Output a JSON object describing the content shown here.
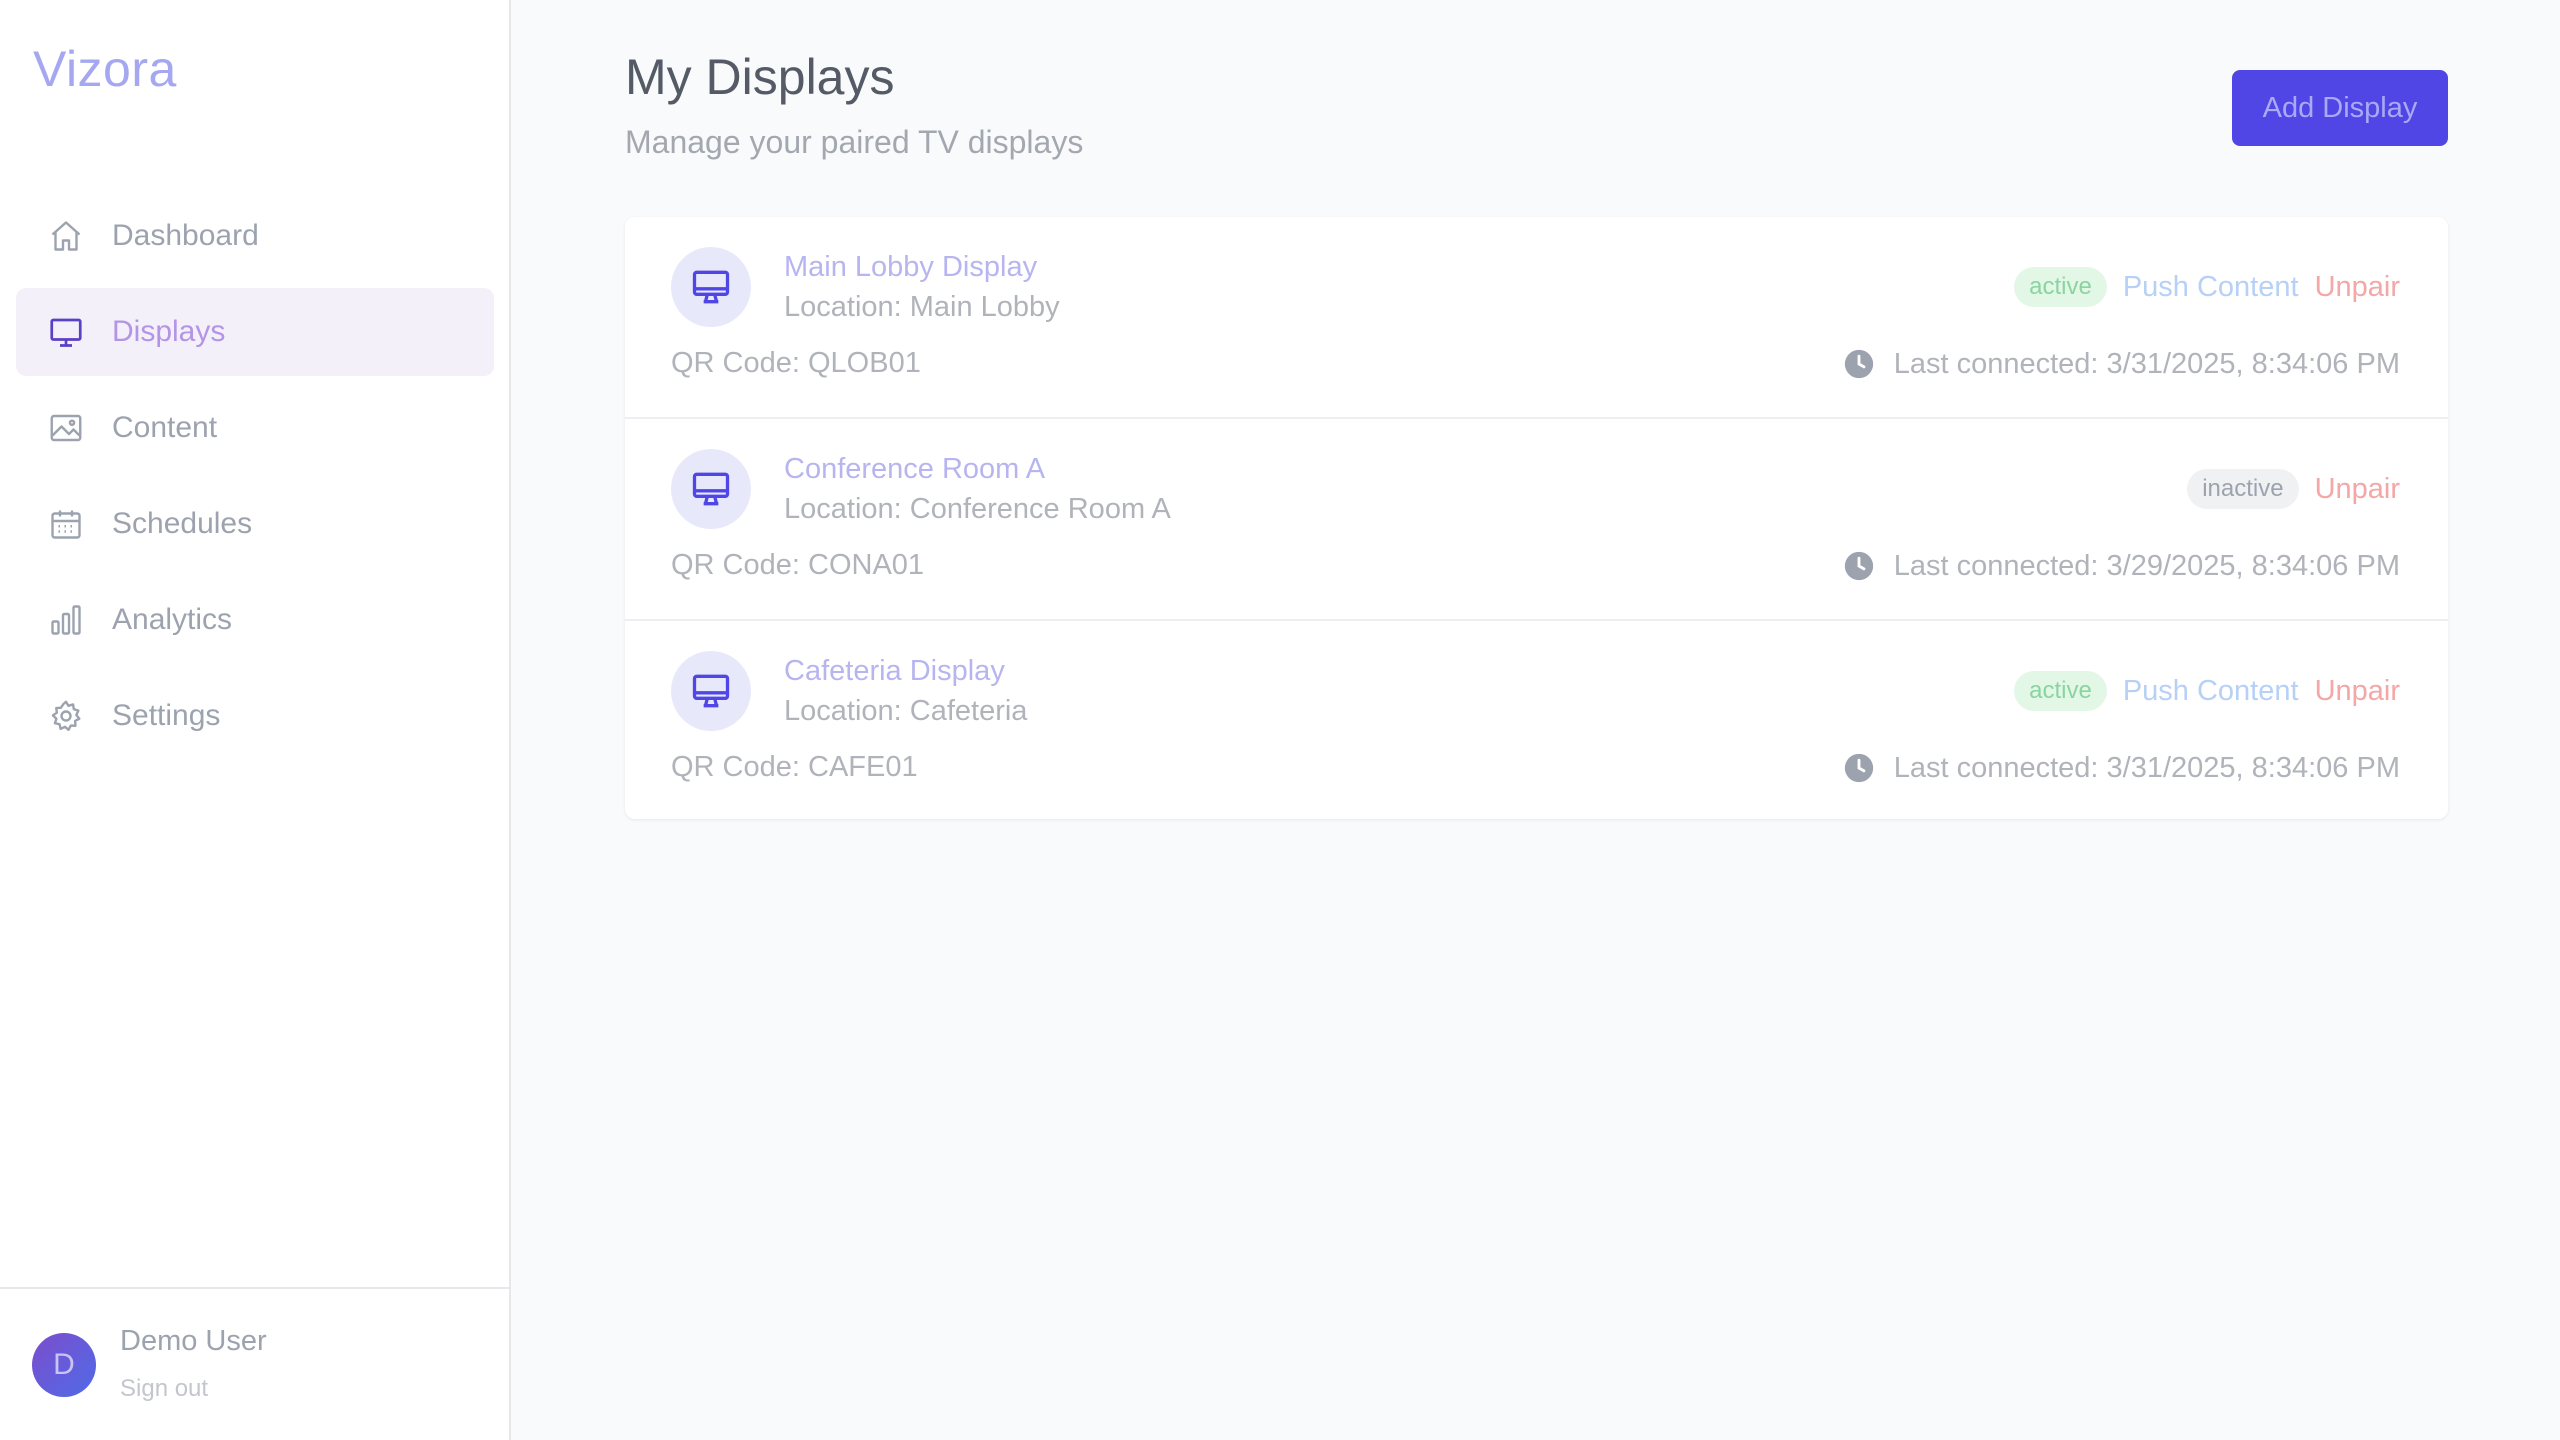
{
  "app": {
    "name": "Vizora"
  },
  "sidebar": {
    "items": [
      {
        "label": "Dashboard",
        "icon": "home-icon",
        "active": false
      },
      {
        "label": "Displays",
        "icon": "monitor-icon",
        "active": true
      },
      {
        "label": "Content",
        "icon": "image-icon",
        "active": false
      },
      {
        "label": "Schedules",
        "icon": "calendar-icon",
        "active": false
      },
      {
        "label": "Analytics",
        "icon": "bar-chart-icon",
        "active": false
      },
      {
        "label": "Settings",
        "icon": "gear-icon",
        "active": false
      }
    ]
  },
  "user": {
    "initial": "D",
    "name": "Demo User",
    "sign_out": "Sign out"
  },
  "header": {
    "title": "My Displays",
    "subtitle": "Manage your paired TV displays",
    "add_button": "Add Display"
  },
  "displays": [
    {
      "name": "Main Lobby Display",
      "location": "Location: Main Lobby",
      "qr": "QR Code: QLOB01",
      "status": "active",
      "push_label": "Push Content",
      "unpair_label": "Unpair",
      "last_connected": "Last connected: 3/31/2025, 8:34:06 PM"
    },
    {
      "name": "Conference Room A",
      "location": "Location: Conference Room A",
      "qr": "QR Code: CONA01",
      "status": "inactive",
      "unpair_label": "Unpair",
      "last_connected": "Last connected: 3/29/2025, 8:34:06 PM"
    },
    {
      "name": "Cafeteria Display",
      "location": "Location: Cafeteria",
      "qr": "QR Code: CAFE01",
      "status": "active",
      "push_label": "Push Content",
      "unpair_label": "Unpair",
      "last_connected": "Last connected: 3/31/2025, 8:34:06 PM"
    }
  ],
  "colors": {
    "accent": "#4f46e5",
    "active_badge_bg": "#e3f7e7",
    "active_badge_text": "#8ad4a0",
    "unpair": "#f3a7a7",
    "push": "#b6d0f6"
  }
}
